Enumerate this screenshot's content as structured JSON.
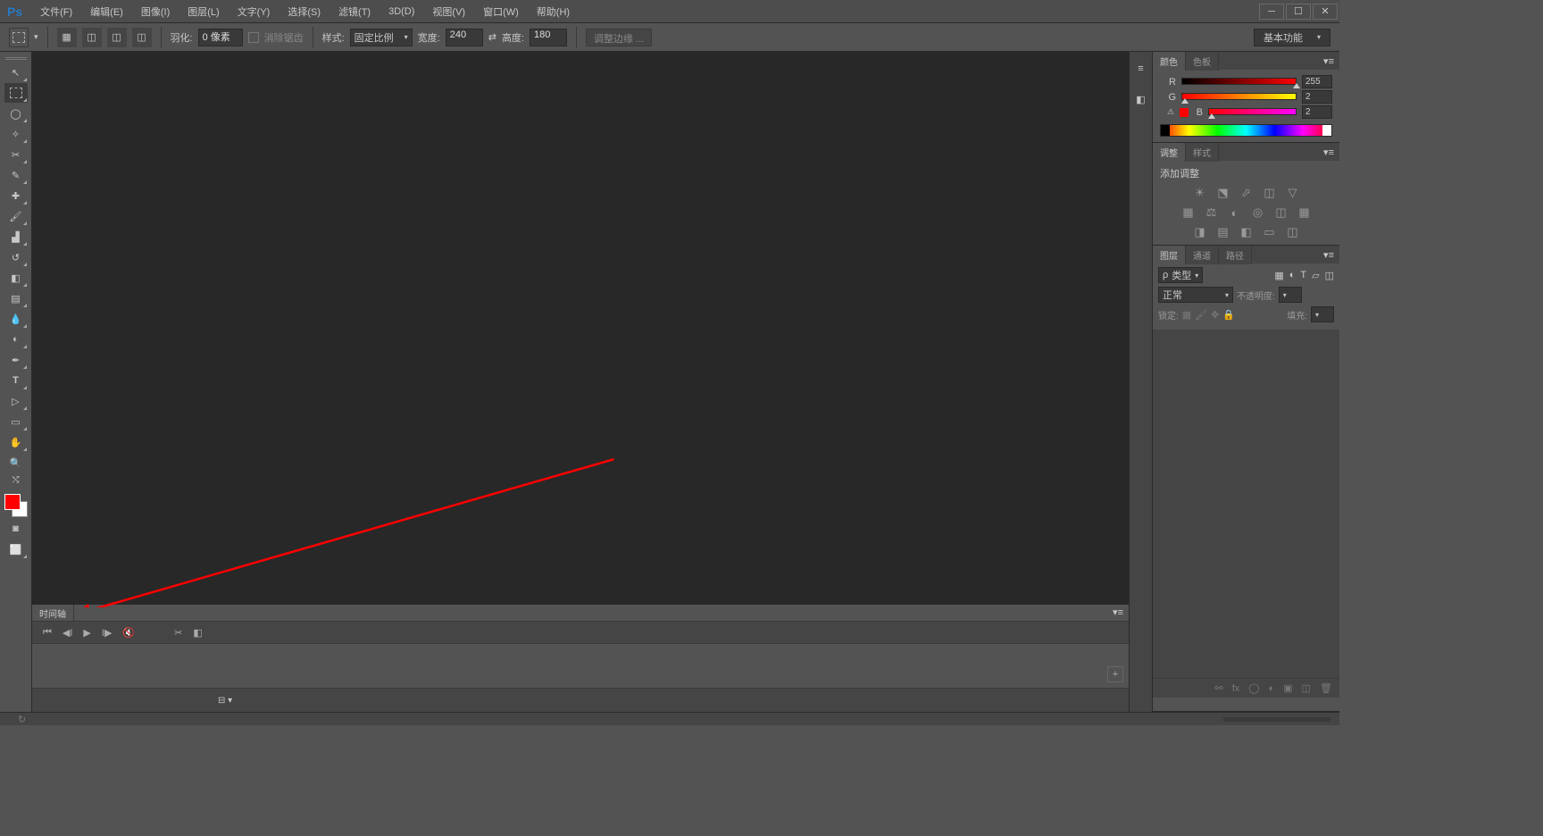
{
  "menubar": {
    "logo": "Ps",
    "items": [
      "文件(F)",
      "编辑(E)",
      "图像(I)",
      "图层(L)",
      "文字(Y)",
      "选择(S)",
      "滤镜(T)",
      "3D(D)",
      "视图(V)",
      "窗口(W)",
      "帮助(H)"
    ]
  },
  "options": {
    "feather_label": "羽化:",
    "feather_value": "0 像素",
    "antialias_label": "消除锯齿",
    "style_label": "样式:",
    "style_value": "固定比例",
    "width_label": "宽度:",
    "width_value": "240",
    "height_label": "高度:",
    "height_value": "180",
    "refine_edge": "调整边缘 ...",
    "workspace": "基本功能"
  },
  "color_panel": {
    "tabs": [
      "颜色",
      "色板"
    ],
    "r_label": "R",
    "r_val": "255",
    "g_label": "G",
    "g_val": "2",
    "b_label": "B",
    "b_val": "2"
  },
  "adjust_panel": {
    "tabs": [
      "调整",
      "样式"
    ],
    "title": "添加调整"
  },
  "layers_panel": {
    "tabs": [
      "图层",
      "通道",
      "路径"
    ],
    "kind_label": "类型",
    "blend_value": "正常",
    "opacity_label": "不透明度:",
    "lock_label": "锁定:",
    "fill_label": "填充:"
  },
  "timeline": {
    "tab": "时间轴"
  },
  "status": {
    "doc": ""
  }
}
